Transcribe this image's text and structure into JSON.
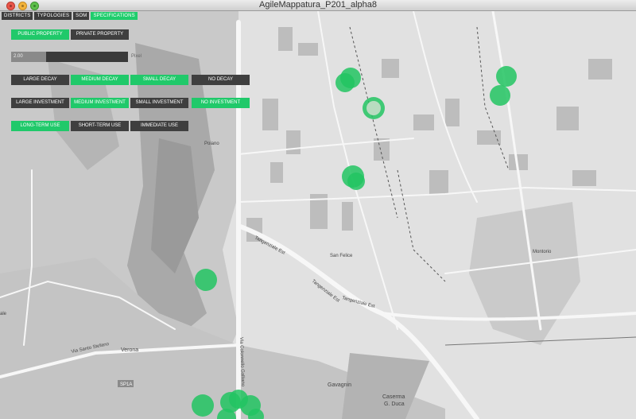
{
  "window": {
    "title": "AgileMappatura_P201_alpha8"
  },
  "tabs": [
    "DISTRICTS",
    "TYPOLOGIES",
    "SOM",
    "SPECIFICATIONS"
  ],
  "active_tab": "SPECIFICATIONS",
  "property": {
    "public_label": "PUBLIC PROPERTY",
    "private_label": "PRIVATE PROPERTY",
    "active": "PUBLIC PROPERTY"
  },
  "slider": {
    "value_text": "2.00",
    "label": "Pixel",
    "level_fraction": 0.3
  },
  "decay": {
    "large": "LARGE DECAY",
    "medium": "MEDIUM DECAY",
    "small": "SMALL DECAY",
    "none": "NO DECAY",
    "active": [
      "MEDIUM DECAY",
      "SMALL DECAY"
    ]
  },
  "investment": {
    "large": "LARGE INVESTMENT",
    "medium": "MEDIUM INVESTMENT",
    "small": "SMALL INVESTMENT",
    "none": "NO INVESTMENT",
    "active": [
      "MEDIUM INVESTMENT",
      "NO INVESTMENT"
    ]
  },
  "use": {
    "long": "LONG-TERM USE",
    "short": "SHORT-TERM USE",
    "immediate": "IMMEDIATE USE",
    "active": [
      "LONG-TERM USE"
    ]
  },
  "map_labels": {
    "poiano": "Poiano",
    "san_felice": "San Felice",
    "montorio": "Montorio",
    "tangenziale_1": "Tangenziale Est",
    "tangenziale_2": "Tangenziale Est",
    "tangenziale_3": "Tangenziale Est",
    "via_santo_stefano": "Via Santo Stefano",
    "verona": "Verona",
    "via_colonnello": "Via Colonnello Galliano",
    "sp1a": "SP1A",
    "gavagnin": "Gavagnin",
    "caserma": "Caserma",
    "g_duca": "G. Duca",
    "ale": "ale"
  },
  "colors": {
    "accent": "#1fcd6c",
    "marker": "#22c462",
    "marker_highlight": "#b8dcc0",
    "button_off": "#3f3f3f"
  }
}
